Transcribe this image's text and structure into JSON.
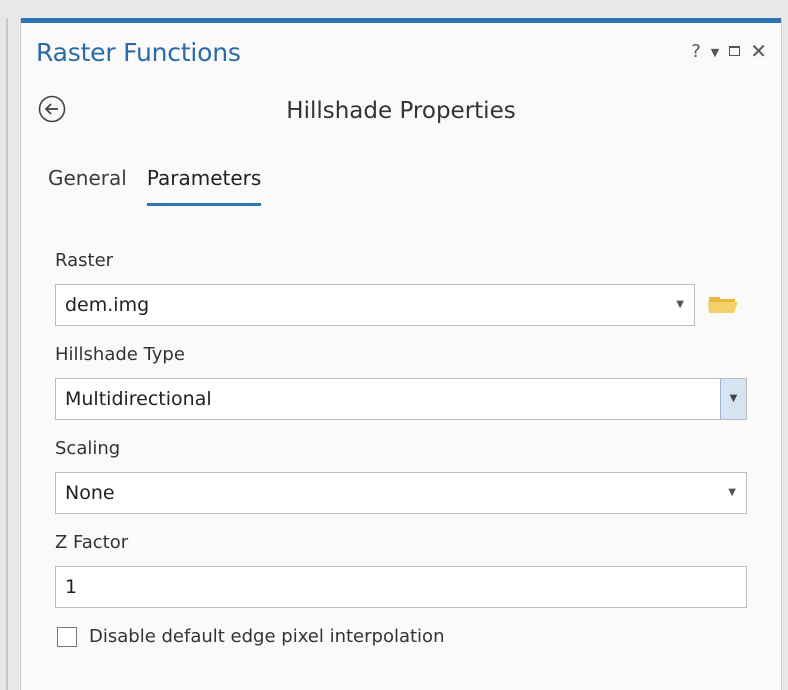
{
  "panel": {
    "title": "Raster Functions",
    "controls": {
      "help_label": "?",
      "menu_icon": "chevron-down-icon",
      "maximize_icon": "maximize-icon",
      "close_label": "✕"
    }
  },
  "header": {
    "back_icon": "back-arrow-icon",
    "title": "Hillshade Properties"
  },
  "tabs": [
    {
      "label": "General",
      "active": false
    },
    {
      "label": "Parameters",
      "active": true
    }
  ],
  "fields": {
    "raster": {
      "label": "Raster",
      "value": "dem.img",
      "browse_icon": "folder-open-icon"
    },
    "hillshade_type": {
      "label": "Hillshade Type",
      "value": "Multidirectional"
    },
    "scaling": {
      "label": "Scaling",
      "value": "None"
    },
    "z_factor": {
      "label": "Z Factor",
      "value": "1"
    }
  },
  "options": {
    "disable_edge_interpolation": {
      "label": "Disable default edge pixel interpolation",
      "checked": false
    }
  },
  "colors": {
    "accent": "#2e74b5",
    "title_text": "#2b6aa8",
    "folder": "#f2c94c"
  }
}
